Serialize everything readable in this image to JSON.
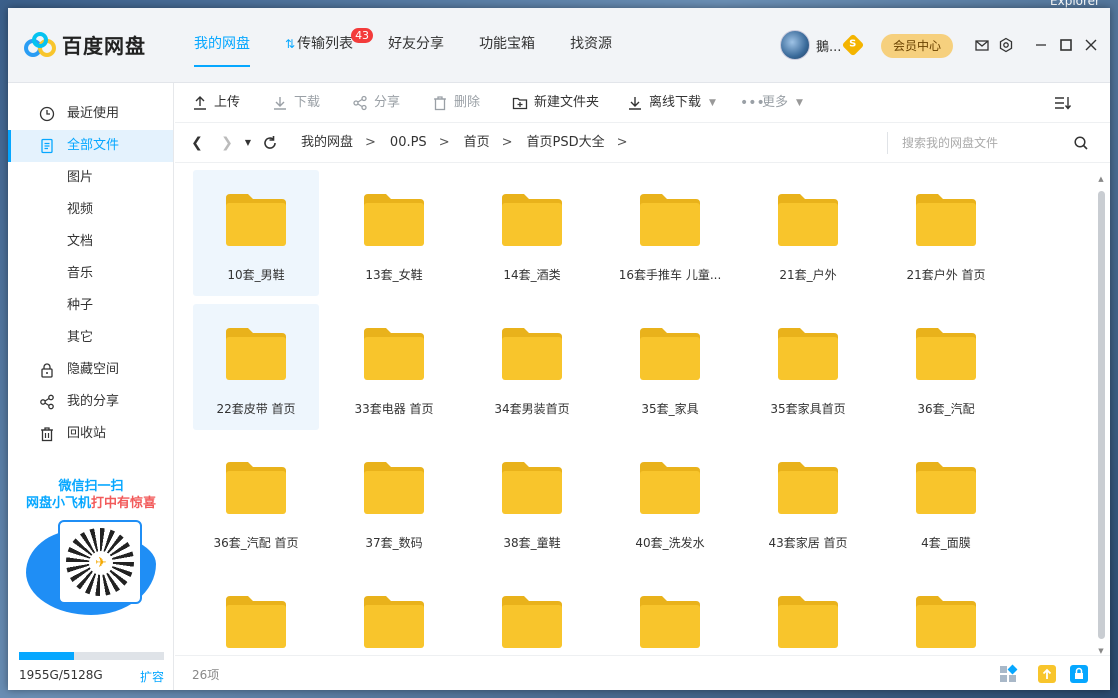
{
  "desktop": {
    "label": "Explorer"
  },
  "app": {
    "name": "百度网盘"
  },
  "nav": [
    {
      "label": "我的网盘",
      "active": true
    },
    {
      "label": "传输列表",
      "badge": "43",
      "icon": "transfer-arrows-icon"
    },
    {
      "label": "好友分享"
    },
    {
      "label": "功能宝箱"
    },
    {
      "label": "找资源"
    }
  ],
  "user": {
    "name": "鵝...",
    "vip_badge": "S",
    "vip_button": "会员中心"
  },
  "sidebar": {
    "items": [
      {
        "label": "最近使用",
        "icon": "clock-icon"
      },
      {
        "label": "全部文件",
        "icon": "file-icon",
        "active": true
      },
      {
        "label": "图片"
      },
      {
        "label": "视频"
      },
      {
        "label": "文档"
      },
      {
        "label": "音乐"
      },
      {
        "label": "种子"
      },
      {
        "label": "其它"
      },
      {
        "label": "隐藏空间",
        "icon": "lock-icon"
      },
      {
        "label": "我的分享",
        "icon": "share-icon"
      },
      {
        "label": "回收站",
        "icon": "trash-icon"
      }
    ],
    "promo": {
      "line1": "微信扫一扫",
      "line2a": "网盘小飞机",
      "line2b": "打中有惊喜"
    },
    "quota": {
      "text": "1955G/5128G",
      "used_fraction": 0.38,
      "expand": "扩容"
    }
  },
  "toolbar": {
    "upload": "上传",
    "download": "下载",
    "share": "分享",
    "delete": "删除",
    "new_folder": "新建文件夹",
    "offline_download": "离线下载",
    "more": "更多"
  },
  "address": {
    "crumbs": [
      "我的网盘",
      "00.PS",
      "首页",
      "首页PSD大全"
    ],
    "search_placeholder": "搜索我的网盘文件"
  },
  "files": [
    "10套_男鞋",
    "13套_女鞋",
    "14套_酒类",
    "16套手推车 儿童...",
    "21套_户外",
    "21套户外 首页",
    "22套皮带 首页",
    "33套电器 首页",
    "34套男装首页",
    "35套_家具",
    "35套家具首页",
    "36套_汽配",
    "36套_汽配 首页",
    "37套_数码",
    "38套_童鞋",
    "40套_洗发水",
    "43套家居 首页",
    "4套_面膜",
    "",
    "",
    "",
    "",
    "",
    ""
  ],
  "status": {
    "count": "26项"
  },
  "colors": {
    "accent": "#06a7ff",
    "folder": "#f8c52c",
    "folder_tab": "#e9b21b",
    "badge": "#f33b3b"
  }
}
